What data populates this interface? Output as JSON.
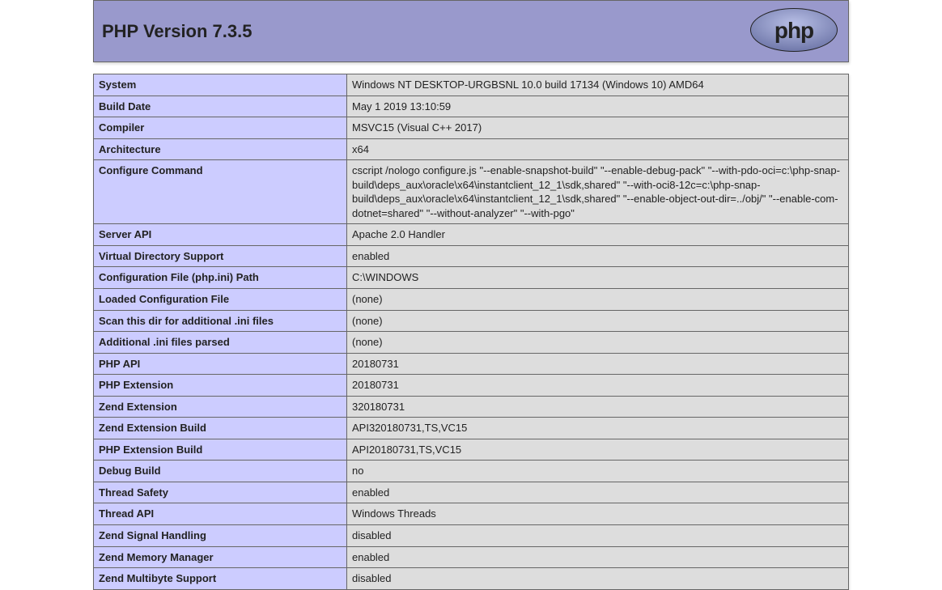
{
  "header": {
    "title": "PHP Version 7.3.5"
  },
  "rows": [
    {
      "label": "System",
      "value": "Windows NT DESKTOP-URGBSNL 10.0 build 17134 (Windows 10) AMD64"
    },
    {
      "label": "Build Date",
      "value": "May 1 2019 13:10:59"
    },
    {
      "label": "Compiler",
      "value": "MSVC15 (Visual C++ 2017)"
    },
    {
      "label": "Architecture",
      "value": "x64"
    },
    {
      "label": "Configure Command",
      "value": "cscript /nologo configure.js \"--enable-snapshot-build\" \"--enable-debug-pack\" \"--with-pdo-oci=c:\\php-snap-build\\deps_aux\\oracle\\x64\\instantclient_12_1\\sdk,shared\" \"--with-oci8-12c=c:\\php-snap-build\\deps_aux\\oracle\\x64\\instantclient_12_1\\sdk,shared\" \"--enable-object-out-dir=../obj/\" \"--enable-com-dotnet=shared\" \"--without-analyzer\" \"--with-pgo\""
    },
    {
      "label": "Server API",
      "value": "Apache 2.0 Handler"
    },
    {
      "label": "Virtual Directory Support",
      "value": "enabled"
    },
    {
      "label": "Configuration File (php.ini) Path",
      "value": "C:\\WINDOWS"
    },
    {
      "label": "Loaded Configuration File",
      "value": "(none)"
    },
    {
      "label": "Scan this dir for additional .ini files",
      "value": "(none)"
    },
    {
      "label": "Additional .ini files parsed",
      "value": "(none)"
    },
    {
      "label": "PHP API",
      "value": "20180731"
    },
    {
      "label": "PHP Extension",
      "value": "20180731"
    },
    {
      "label": "Zend Extension",
      "value": "320180731"
    },
    {
      "label": "Zend Extension Build",
      "value": "API320180731,TS,VC15"
    },
    {
      "label": "PHP Extension Build",
      "value": "API20180731,TS,VC15"
    },
    {
      "label": "Debug Build",
      "value": "no"
    },
    {
      "label": "Thread Safety",
      "value": "enabled"
    },
    {
      "label": "Thread API",
      "value": "Windows Threads"
    },
    {
      "label": "Zend Signal Handling",
      "value": "disabled"
    },
    {
      "label": "Zend Memory Manager",
      "value": "enabled"
    },
    {
      "label": "Zend Multibyte Support",
      "value": "disabled"
    }
  ]
}
